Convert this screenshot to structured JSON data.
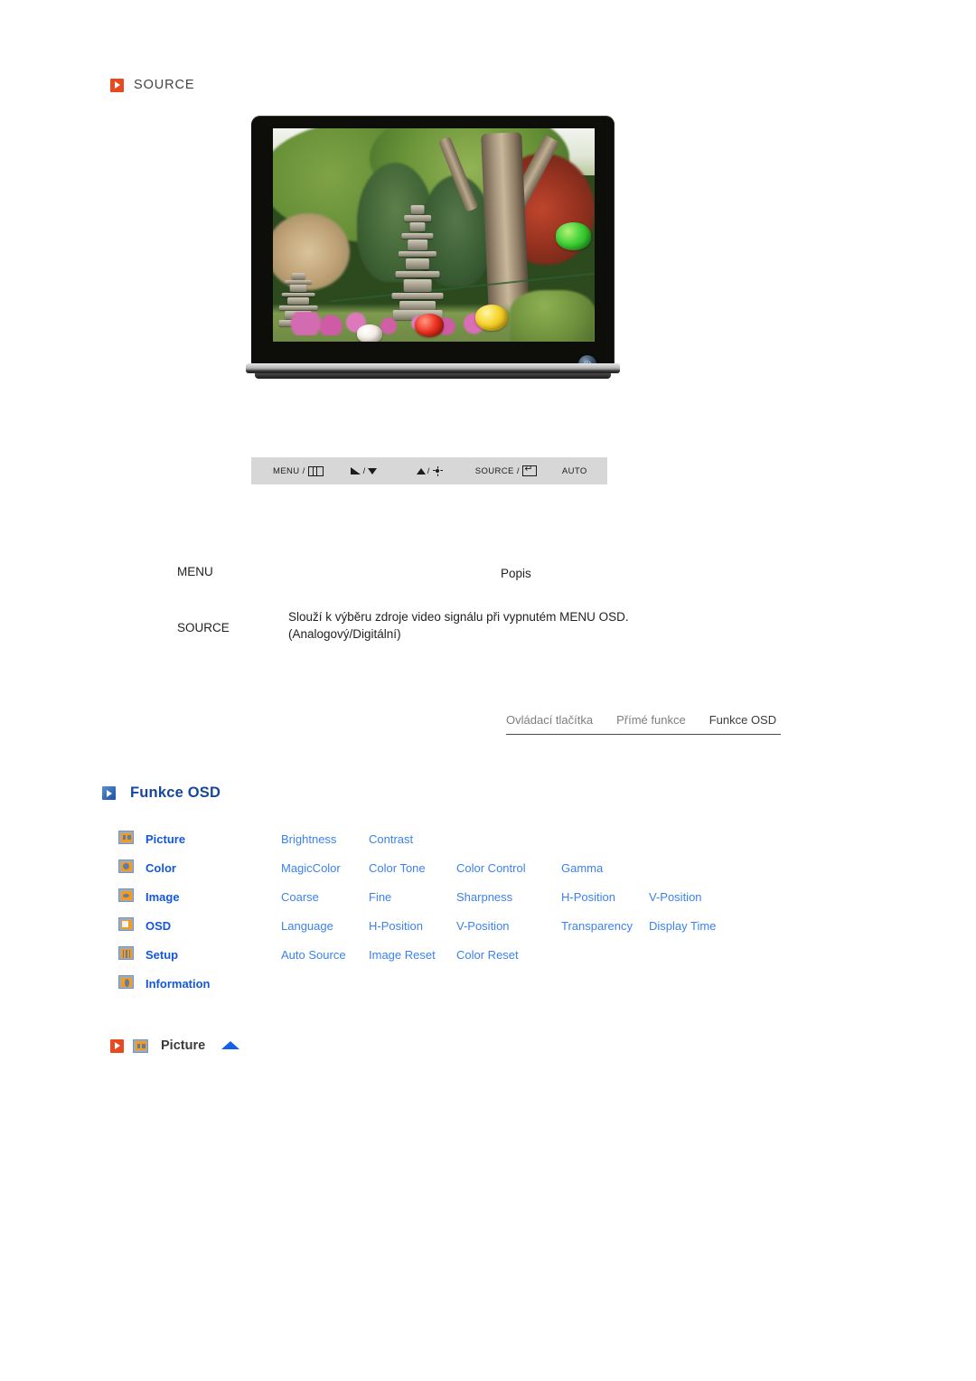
{
  "source_section": {
    "label": "SOURCE",
    "bullet_icon": "red-arrow-bullet-icon"
  },
  "monitor": {
    "alt": "LCD monitor displaying a garden photograph with stone pagodas, trees and paper lanterns",
    "power_button_icon": "power-button-icon"
  },
  "control_panel": {
    "buttons": [
      {
        "label": "MENU /",
        "icon": "menu-grid-icon"
      },
      {
        "label": "/",
        "icon_left": "volume-icon",
        "icon_right": "triangle-down-icon"
      },
      {
        "label": "/",
        "icon_left": "triangle-up-icon",
        "icon_right": "brightness-sun-icon"
      },
      {
        "label": "SOURCE /",
        "icon": "enter-key-icon"
      },
      {
        "label": "AUTO",
        "icon": ""
      }
    ],
    "menu_label": "MENU /",
    "source_label": "SOURCE /",
    "auto_label": "AUTO",
    "slash": "/"
  },
  "menu_table": {
    "header": {
      "menu": "MENU",
      "popis": "Popis"
    },
    "rows": [
      {
        "menu": "SOURCE",
        "desc_line1": "Slouží k výběru zdroje video signálu při vypnutém MENU OSD.",
        "desc_line2": "(Analogový/Digitální)"
      }
    ]
  },
  "nav_tabs": [
    {
      "label": "Ovládací tlačítka",
      "active": false
    },
    {
      "label": "Přímé funkce",
      "active": false
    },
    {
      "label": "Funkce OSD",
      "active": true
    }
  ],
  "osd_heading": {
    "title": "Funkce OSD",
    "bullet_icon": "blue-arrow-bullet-icon"
  },
  "osd_table": {
    "rows": [
      {
        "icon": "picture-icon",
        "category": "Picture",
        "items": [
          "Brightness",
          "Contrast"
        ]
      },
      {
        "icon": "color-icon",
        "category": "Color",
        "items": [
          "MagicColor",
          "Color Tone",
          "Color Control",
          "Gamma"
        ]
      },
      {
        "icon": "image-icon",
        "category": "Image",
        "items": [
          "Coarse",
          "Fine",
          "Sharpness",
          "H-Position",
          "V-Position"
        ]
      },
      {
        "icon": "osd-icon",
        "category": "OSD",
        "items": [
          "Language",
          "H-Position",
          "V-Position",
          "Transparency",
          "Display Time"
        ]
      },
      {
        "icon": "setup-icon",
        "category": "Setup",
        "items": [
          "Auto Source",
          "Image Reset",
          "Color Reset"
        ]
      },
      {
        "icon": "information-icon",
        "category": "Information",
        "items": []
      }
    ]
  },
  "picture_bar": {
    "bullet_icon": "red-arrow-bullet-icon",
    "category_icon": "picture-icon",
    "title": "Picture",
    "top_arrow_icon": "scroll-to-top-arrow-icon"
  },
  "colors": {
    "red_accent": "#e8491f",
    "blue_heading": "#15479b",
    "blue_category": "#1358d8",
    "blue_link": "#3b82f0",
    "icon_orange": "#f49a1c",
    "panel_gray": "#d7d7d7",
    "tab_gray": "#7d7d7d",
    "tab_active": "#3b3b3b"
  }
}
